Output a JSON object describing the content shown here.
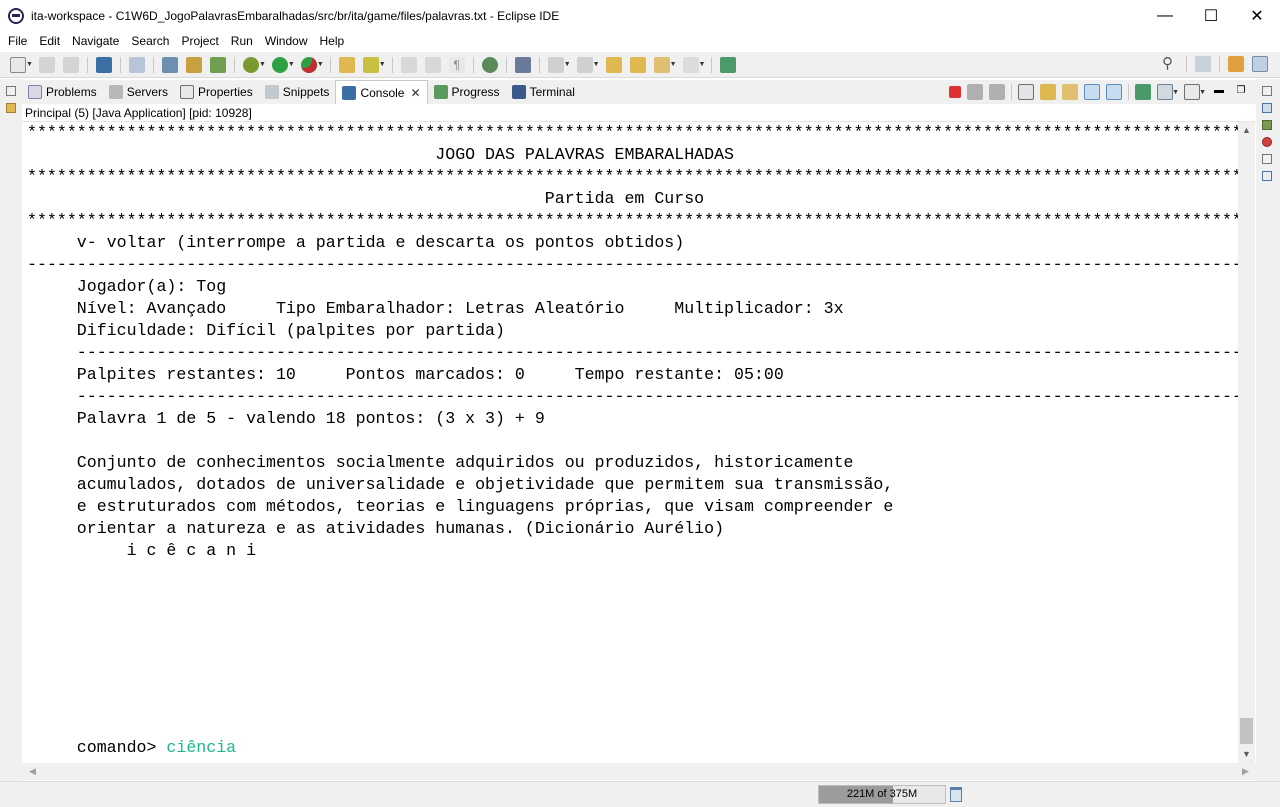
{
  "window": {
    "title": "ita-workspace - C1W6D_JogoPalavrasEmbaralhadas/src/br/ita/game/files/palavras.txt - Eclipse IDE",
    "minimize": "—",
    "maximize": "☐",
    "close": "✕"
  },
  "menu": [
    "File",
    "Edit",
    "Navigate",
    "Search",
    "Project",
    "Run",
    "Window",
    "Help"
  ],
  "tabs": [
    {
      "label": "Problems",
      "icon": "problems-icon"
    },
    {
      "label": "Servers",
      "icon": "servers-icon"
    },
    {
      "label": "Properties",
      "icon": "properties-icon"
    },
    {
      "label": "Snippets",
      "icon": "snippets-icon"
    },
    {
      "label": "Console",
      "icon": "console-icon",
      "active": true,
      "close": "✕"
    },
    {
      "label": "Progress",
      "icon": "progress-icon"
    },
    {
      "label": "Terminal",
      "icon": "terminal-icon"
    }
  ],
  "console": {
    "description": "Principal (5) [Java Application]  [pid: 10928]",
    "lines": [
      "******************************************************************************************************************************",
      "                                         JOGO DAS PALAVRAS EMBARALHADAS",
      "******************************************************************************************************************************",
      "                                                    Partida em Curso",
      "******************************************************************************************************************************",
      "     v- voltar (interrompe a partida e descarta os pontos obtidos)",
      "------------------------------------------------------------------------------------------------------------------------------",
      "     Jogador(a): Tog",
      "     Nível: Avançado     Tipo Embaralhador: Letras Aleatório     Multiplicador: 3x",
      "     Dificuldade: Difícil (palpites por partida)",
      "     -------------------------------------------------------------------------------------------------------------------------",
      "     Palpites restantes: 10     Pontos marcados: 0     Tempo restante: 05:00",
      "     -------------------------------------------------------------------------------------------------------------------------",
      "     Palavra 1 de 5 - valendo 18 pontos: (3 x 3) + 9",
      "",
      "     Conjunto de conhecimentos socialmente adquiridos ou produzidos, historicamente",
      "     acumulados, dotados de universalidade e objetividade que permitem sua transmissão,",
      "     e estruturados com métodos, teorias e linguagens próprias, que visam compreender e",
      "     orientar a natureza e as atividades humanas. (Dicionário Aurélio)",
      "          i c ê c a n i"
    ],
    "prompt": "     comando> ",
    "input": "ciência",
    "input_color": "#1bb88a"
  },
  "status": {
    "heap": "221M of 375M",
    "heap_used_fraction": 0.59
  },
  "colors": {
    "terminate": "#e03030",
    "run": "#2ea043",
    "debug": "#7a9a30",
    "accent": "#2c5aa0"
  }
}
